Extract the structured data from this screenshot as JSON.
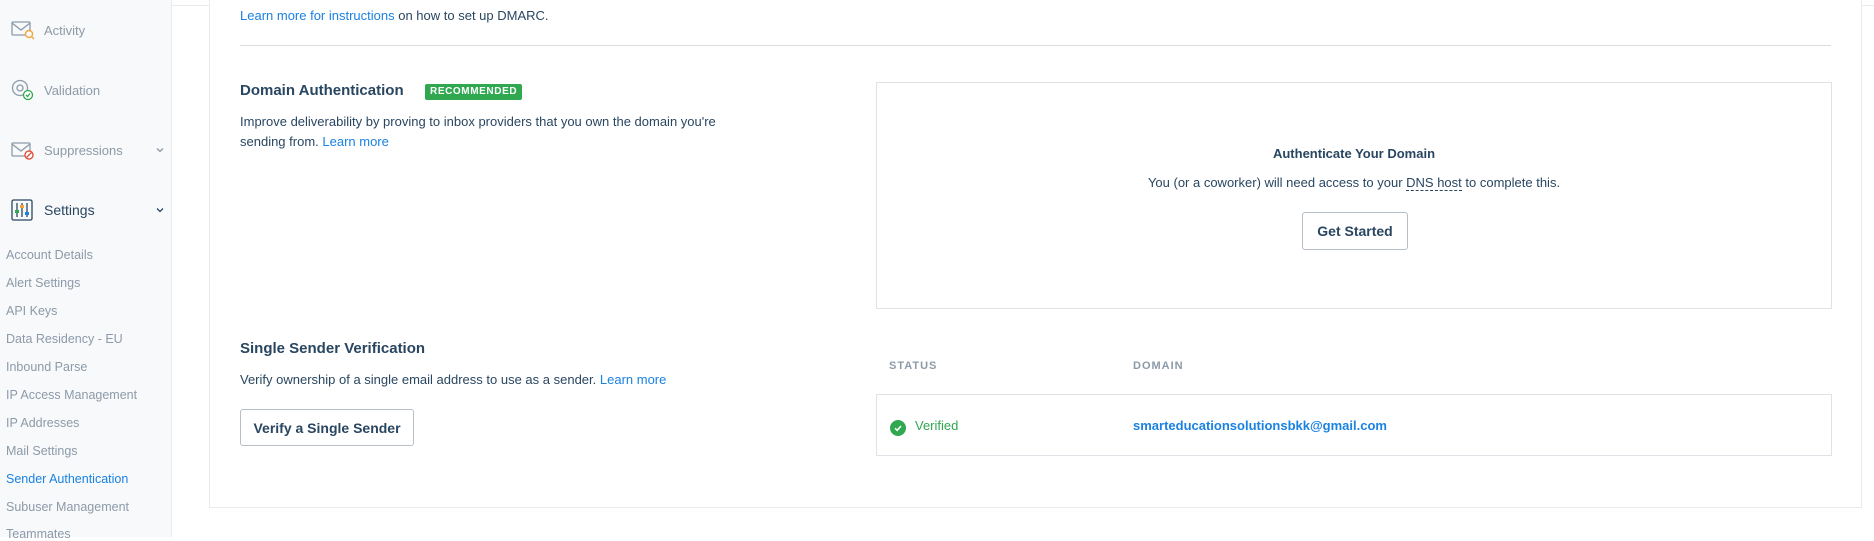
{
  "sidebar": {
    "nav": [
      {
        "label": "Activity",
        "icon": "envelope-search-icon"
      },
      {
        "label": "Validation",
        "icon": "at-check-icon"
      },
      {
        "label": "Suppressions",
        "icon": "envelope-block-icon"
      },
      {
        "label": "Settings",
        "icon": "sliders-icon"
      }
    ],
    "sub_items": [
      "Account Details",
      "Alert Settings",
      "API Keys",
      "Data Residency - EU",
      "Inbound Parse",
      "IP Access Management",
      "IP Addresses",
      "Mail Settings",
      "Sender Authentication",
      "Subuser Management",
      "Teammates"
    ],
    "current_item": "Sender Authentication"
  },
  "dmarc": {
    "link": "Learn more for instructions",
    "text": " on how to set up DMARC."
  },
  "domain_auth": {
    "title": "Domain Authentication",
    "badge": "RECOMMENDED",
    "desc_line1": "Improve deliverability by proving to inbox providers that you own the domain you're",
    "desc_line2": "sending from. ",
    "learn_more": "Learn more",
    "box": {
      "title": "Authenticate Your Domain",
      "text_before": "You (or a coworker) will need access to your ",
      "dns_host": "DNS host",
      "text_after": " to complete this.",
      "button": "Get Started"
    }
  },
  "single_sender": {
    "title": "Single Sender Verification",
    "desc": "Verify ownership of a single email address to use as a sender. ",
    "learn_more": "Learn more",
    "button": "Verify a Single Sender",
    "table": {
      "headers": [
        "STATUS",
        "DOMAIN"
      ],
      "rows": [
        {
          "status": "Verified",
          "domain": "smarteducationsolutionsbkk@gmail.com"
        }
      ]
    }
  },
  "colors": {
    "primary_text": "#294661",
    "muted_text": "#8c9aa9",
    "link": "#1a82e2",
    "success": "#2fa84f"
  }
}
